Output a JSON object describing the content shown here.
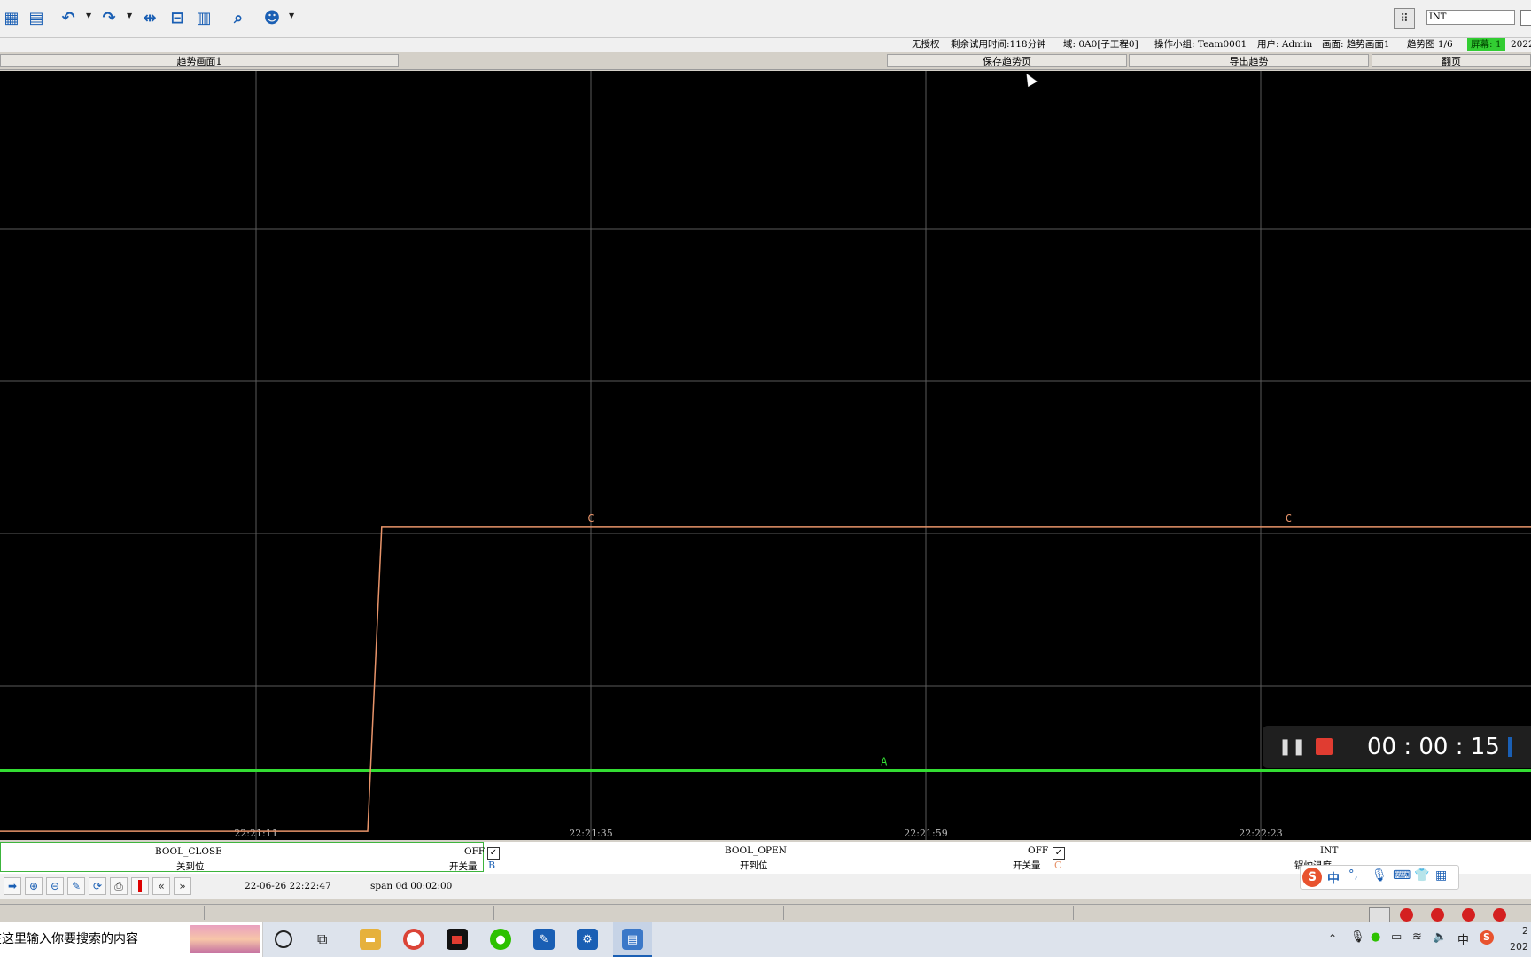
{
  "toolbar": {
    "icons": [
      "window-stack-icon",
      "report-icon",
      "undo-icon",
      "redo-icon",
      "cursor-move-icon",
      "interval-icon",
      "book-icon",
      "search-magnifier-icon",
      "user-icon"
    ],
    "tag_field_value": "INT"
  },
  "status": {
    "license": "无授权",
    "trial": "剩余试用时间:118分钟",
    "domain": "域: 0A0[子工程0]",
    "group": "操作小组: Team0001",
    "user": "用户: Admin",
    "screen": "画面: 趋势画面1",
    "trend_page": "趋势图 1/6",
    "screen_no": "屏幕: 1",
    "date_prefix": "2022"
  },
  "tabs": {
    "title": "趋势画面1",
    "save": "保存趋势页",
    "export": "导出趋势",
    "page": "翻页"
  },
  "chart_data": {
    "type": "line",
    "x_ticks": [
      "22:21:11",
      "22:21:35",
      "22:21:59",
      "22:22:23"
    ],
    "series": [
      {
        "name": "A",
        "color": "#33dd33",
        "points": [
          [
            "22:20:47",
            0.2
          ],
          [
            "22:22:47",
            0.2
          ]
        ],
        "marker_labels": [
          [
            "22:21:56",
            "A"
          ],
          [
            "22:22:46",
            "A"
          ]
        ]
      },
      {
        "name": "C",
        "color": "#e8946a",
        "points": [
          [
            "22:20:47",
            0.0
          ],
          [
            "22:21:19",
            0.0
          ],
          [
            "22:21:20",
            1.0
          ],
          [
            "22:22:47",
            1.0
          ]
        ],
        "marker_labels": [
          [
            "22:20:51",
            "C"
          ],
          [
            "22:21:35",
            "C"
          ],
          [
            "22:22:25",
            "C"
          ]
        ]
      }
    ],
    "ylim": [
      -0.02,
      2.5
    ],
    "xlim": [
      "22:20:47",
      "22:22:47"
    ],
    "grid": true,
    "background": "#000000"
  },
  "legend": {
    "items": [
      {
        "tag": "BOOL_CLOSE",
        "state": "OFF",
        "desc": "关到位",
        "type": "开关量",
        "letter": ""
      },
      {
        "tag": "BOOL_OPEN",
        "state": "OFF",
        "desc": "开到位",
        "type": "开关量",
        "letter": "B"
      },
      {
        "tag": "INT",
        "state": "",
        "desc": "锅炉温度",
        "type": "",
        "letter": "C"
      }
    ]
  },
  "controls": {
    "end_time": "22-06-26 22:22:47",
    "span": "span 0d 00:02:00",
    "buttons": [
      "arrow-right-icon",
      "zoom-in-icon",
      "zoom-out-icon",
      "wrench-icon",
      "refresh-icon",
      "print-icon",
      "red-marker-icon",
      "prev-page-icon",
      "next-page-icon"
    ]
  },
  "recorder": {
    "elapsed": "00 : 00 : 15"
  },
  "ime": {
    "lang": "中"
  },
  "taskbar": {
    "search_placeholder": "在这里输入你要搜索的内容",
    "tray_lang": "中",
    "clock_line1": "2",
    "clock_line2": "202"
  },
  "colors": {
    "grid": "#5a5a5a",
    "accent_blue": "#1a5fb4",
    "series_A": "#33dd33",
    "series_C": "#e8946a"
  }
}
